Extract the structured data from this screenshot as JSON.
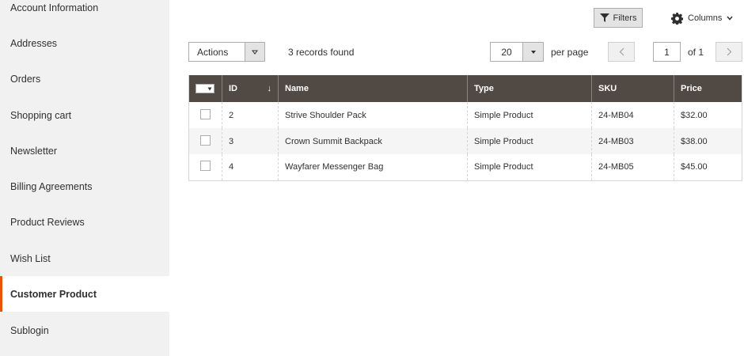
{
  "sidebar": {
    "items": [
      {
        "label": "Account Information",
        "active": false
      },
      {
        "label": "Addresses",
        "active": false
      },
      {
        "label": "Orders",
        "active": false
      },
      {
        "label": "Shopping cart",
        "active": false
      },
      {
        "label": "Newsletter",
        "active": false
      },
      {
        "label": "Billing Agreements",
        "active": false
      },
      {
        "label": "Product Reviews",
        "active": false
      },
      {
        "label": "Wish List",
        "active": false
      },
      {
        "label": "Customer Product",
        "active": true
      },
      {
        "label": "Sublogin",
        "active": false
      }
    ]
  },
  "toolbar": {
    "filters_label": "Filters",
    "columns_label": "Columns",
    "actions_label": "Actions",
    "records_found": "3 records found",
    "per_page_value": "20",
    "per_page_label": "per page",
    "current_page": "1",
    "of_pages": "of 1"
  },
  "grid": {
    "columns": [
      "ID",
      "Name",
      "Type",
      "SKU",
      "Price"
    ],
    "sort_indicator": "↓",
    "rows": [
      {
        "id": "2",
        "name": "Strive Shoulder Pack",
        "type": "Simple Product",
        "sku": "24-MB04",
        "price": "$32.00"
      },
      {
        "id": "3",
        "name": "Crown Summit Backpack",
        "type": "Simple Product",
        "sku": "24-MB03",
        "price": "$38.00"
      },
      {
        "id": "4",
        "name": "Wayfarer Messenger Bag",
        "type": "Simple Product",
        "sku": "24-MB05",
        "price": "$45.00"
      }
    ]
  },
  "icons": {
    "filters": "filter-icon",
    "columns": "gear-icon",
    "prev": "chevron-left-icon",
    "next": "chevron-right-icon"
  },
  "colors": {
    "accent": "#eb5202",
    "header_bg": "#514943",
    "sidebar_bg": "#f1f1f1"
  }
}
